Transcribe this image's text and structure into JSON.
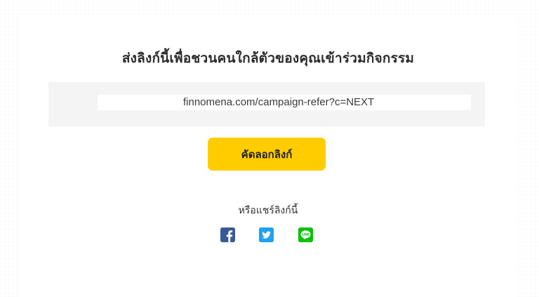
{
  "invite": {
    "title": "ส่งลิงก์นี้เพื่อชวนคนใกล้ตัวของคุณเข้าร่วมกิจกรรม",
    "link": "finnomena.com/campaign-refer?c=NEXT",
    "copy_label": "คัดลอกลิงก์"
  },
  "share": {
    "label": "หรือแชร์ลิงก์นี้",
    "icons": [
      "facebook-icon",
      "twitter-icon",
      "line-icon"
    ]
  },
  "colors": {
    "button": "#ffcc00",
    "facebook": "#3b5998",
    "twitter": "#1da1f2",
    "line": "#00c300"
  }
}
